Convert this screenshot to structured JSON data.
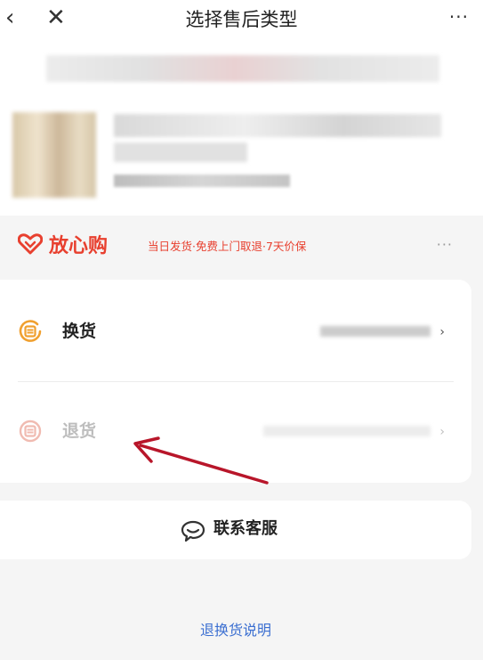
{
  "header": {
    "back_glyph": "‹",
    "close_glyph": "✕",
    "title": "选择售后类型",
    "more_glyph": "···"
  },
  "assurance": {
    "brand": "放心购",
    "description": "当日发货·免费上门取退·7天价保",
    "more_glyph": "···",
    "brand_color": "#e8402f"
  },
  "options": [
    {
      "label": "换货",
      "icon": "exchange-icon",
      "chevron": "›",
      "state": "enabled"
    },
    {
      "label": "退货",
      "icon": "return-icon",
      "chevron": "›",
      "state": "disabled"
    }
  ],
  "service": {
    "label": "联系客服",
    "icon": "customer-service-icon"
  },
  "footer": {
    "link": "退换货说明",
    "link_color": "#3b6fd1"
  },
  "annotation": {
    "arrow_color": "#b8162a"
  }
}
